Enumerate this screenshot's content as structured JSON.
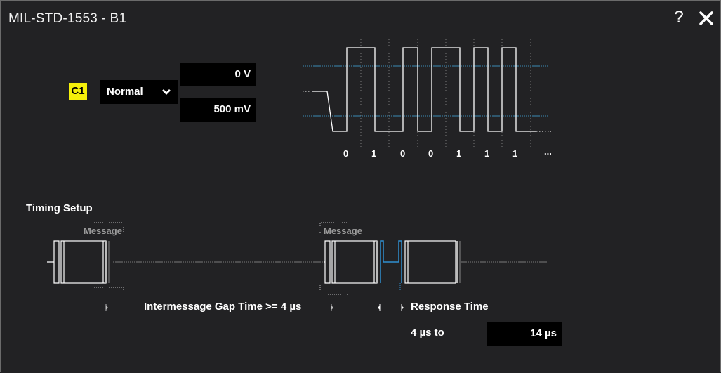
{
  "window": {
    "title": "MIL-STD-1553 - B1",
    "help_label": "?",
    "close_icon": "close-icon"
  },
  "source": {
    "channel": "C1",
    "channel_color": "#f5f00a",
    "mode": "Normal",
    "upper_threshold": "0 V",
    "lower_threshold": "500 mV"
  },
  "signal_preview": {
    "bits": [
      "0",
      "1",
      "0",
      "0",
      "1",
      "1",
      "1",
      "..."
    ],
    "trace_color": "#ffffff",
    "threshold_color": "#3a8bb5"
  },
  "timing": {
    "section_label": "Timing Setup",
    "message_label_1": "Message",
    "message_label_2": "Message",
    "intermessage_gap": "Intermessage Gap Time >= 4 µs",
    "response_time_label": "Response Time",
    "response_from": "4 µs to",
    "response_to": "14 µs",
    "response_color": "#2f8fd0"
  }
}
